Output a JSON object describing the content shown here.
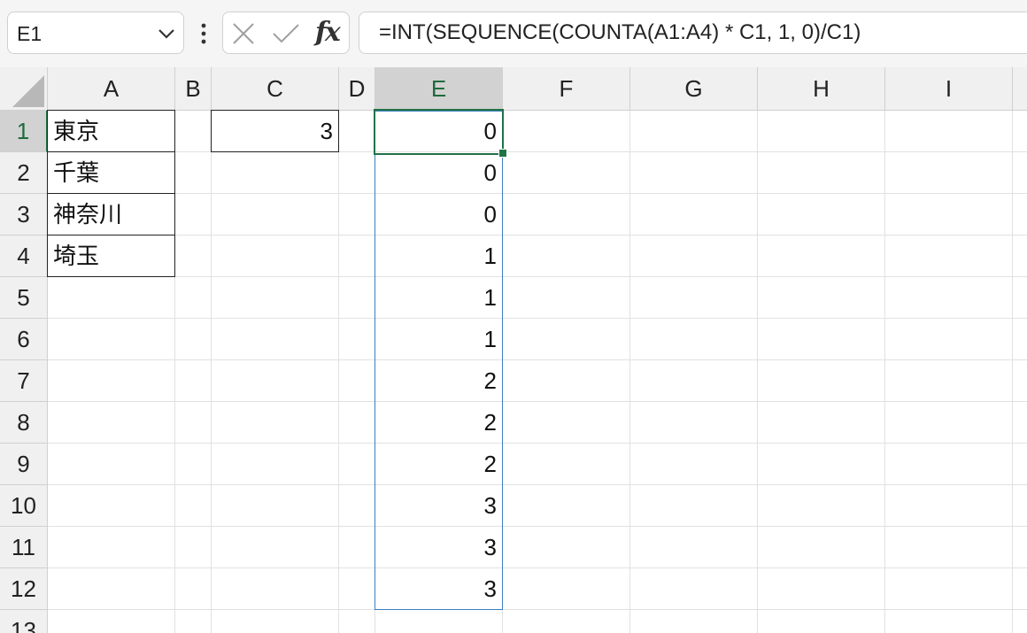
{
  "name_box": {
    "value": "E1"
  },
  "formula_bar": {
    "fx_label": "fx",
    "formula": "=INT(SEQUENCE(COUNTA(A1:A4) * C1, 1, 0)/C1)"
  },
  "columns": [
    "A",
    "B",
    "C",
    "D",
    "E",
    "F",
    "G",
    "H",
    "I"
  ],
  "rows": [
    "1",
    "2",
    "3",
    "4",
    "5",
    "6",
    "7",
    "8",
    "9",
    "10",
    "11",
    "12",
    "13"
  ],
  "active_column": "E",
  "active_row": "1",
  "cells": {
    "A": [
      "東京",
      "千葉",
      "神奈川",
      "埼玉"
    ],
    "C": [
      "3"
    ],
    "E": [
      "0",
      "0",
      "0",
      "1",
      "1",
      "1",
      "2",
      "2",
      "2",
      "3",
      "3",
      "3"
    ]
  },
  "colors": {
    "accent_green": "#217346",
    "spill_blue": "#3a7ebf",
    "grid_line": "#e1e1e1"
  }
}
